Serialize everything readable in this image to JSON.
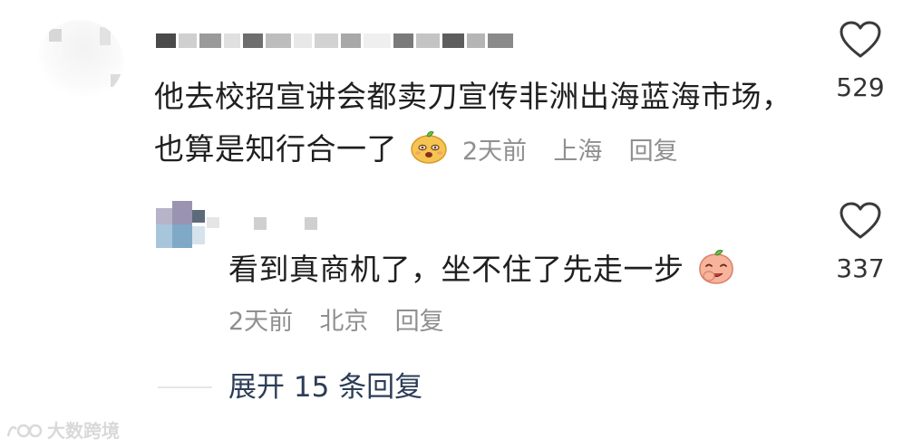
{
  "comments": [
    {
      "text": "他去校招宣讲会都卖刀宣传非洲出海蓝海市场，也算是知行合一了",
      "time": "2天前",
      "location": "上海",
      "reply_label": "回复",
      "likes": "529",
      "emoji_icon": "smug-face-emoji-icon"
    },
    {
      "text": "看到真商机了，坐不住了先走一步",
      "time": "2天前",
      "location": "北京",
      "reply_label": "回复",
      "likes": "337",
      "emoji_icon": "laughing-peach-emoji-icon"
    }
  ],
  "expand_replies": "展开 15 条回复",
  "watermark": "大数跨境",
  "colors": {
    "text": "#1f1f1f",
    "meta": "#8f8f8f",
    "link": "#2c3d57",
    "heart": "#3a3a3a"
  }
}
